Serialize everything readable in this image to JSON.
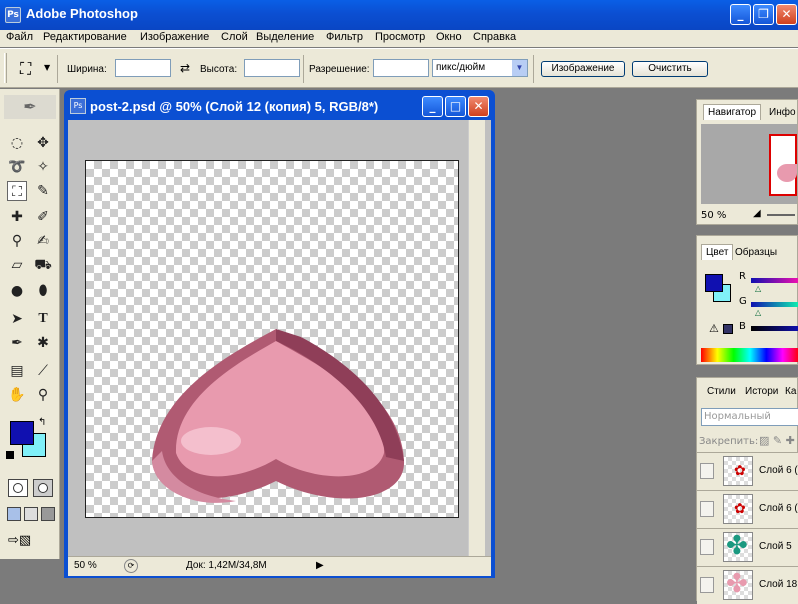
{
  "app": {
    "title": "Adobe Photoshop",
    "min": "_",
    "restore": "❐",
    "close": "✕"
  },
  "menu": [
    "Файл",
    "Редактирование",
    "Изображение",
    "Слой",
    "Выделение",
    "Фильтр",
    "Просмотр",
    "Окно",
    "Справка"
  ],
  "options": {
    "width_label": "Ширина:",
    "height_label": "Высота:",
    "resolution_label": "Разрешение:",
    "units": "пикс/дюйм",
    "image_button": "Изображение",
    "clear_button": "Очистить"
  },
  "document": {
    "title": "post-2.psd @ 50% (Слой 12 (копия) 5, RGB/8*)",
    "zoom": "50 %",
    "doc_info": "Док: 1,42M/34,8M"
  },
  "colors": {
    "foreground": "#1010b0",
    "background": "#80f0f8",
    "heart": "#e89aae"
  },
  "navigator": {
    "tabs": [
      "Навигатор",
      "Инфо"
    ],
    "zoom": "50 %"
  },
  "color_panel": {
    "tabs": [
      "Цвет",
      "Образцы"
    ],
    "channels": [
      "R",
      "G",
      "B"
    ]
  },
  "layers_panel": {
    "tabs": [
      "Стили",
      "Истори",
      "Ка"
    ],
    "blend_mode": "Нормальный",
    "lock_label": "Закрепить:",
    "layers": [
      "Слой 6 (",
      "Слой 6 (",
      "Слой 5",
      "Слой 18"
    ]
  }
}
